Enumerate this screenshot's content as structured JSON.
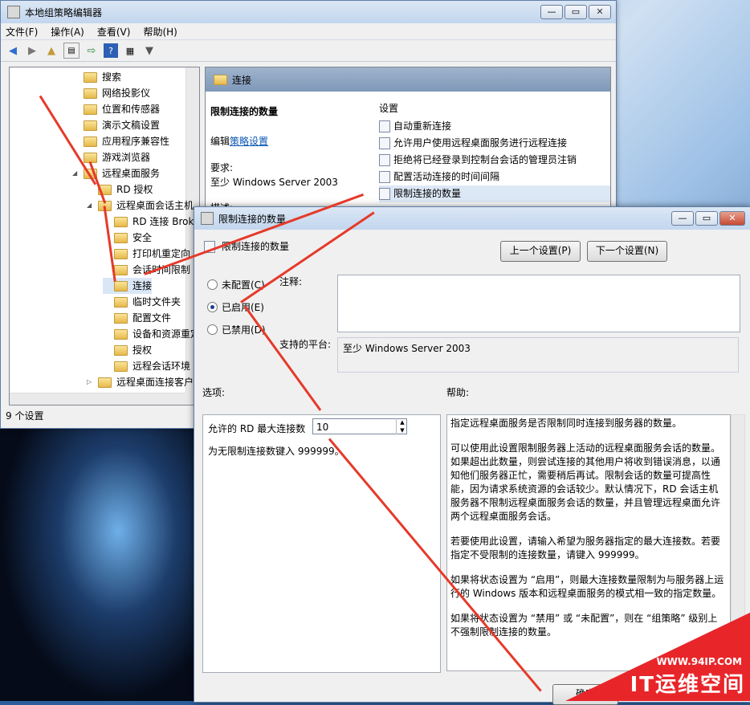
{
  "main_window": {
    "title": "本地组策略编辑器",
    "menu": [
      "文件(F)",
      "操作(A)",
      "查看(V)",
      "帮助(H)"
    ],
    "tree": [
      {
        "label": "搜索",
        "level": 0
      },
      {
        "label": "网络投影仪",
        "level": 0
      },
      {
        "label": "位置和传感器",
        "level": 0
      },
      {
        "label": "演示文稿设置",
        "level": 0
      },
      {
        "label": "应用程序兼容性",
        "level": 0
      },
      {
        "label": "游戏浏览器",
        "level": 0
      },
      {
        "label": "远程桌面服务",
        "level": 0
      },
      {
        "label": "RD 授权",
        "level": 1
      },
      {
        "label": "远程桌面会话主机",
        "level": 1
      },
      {
        "label": "RD 连接 Broke",
        "level": 2
      },
      {
        "label": "安全",
        "level": 2
      },
      {
        "label": "打印机重定向",
        "level": 2
      },
      {
        "label": "会话时间限制",
        "level": 2
      },
      {
        "label": "连接",
        "level": 2
      },
      {
        "label": "临时文件夹",
        "level": 2
      },
      {
        "label": "配置文件",
        "level": 2
      },
      {
        "label": "设备和资源重定",
        "level": 2
      },
      {
        "label": "授权",
        "level": 2
      },
      {
        "label": "远程会话环境",
        "level": 2
      },
      {
        "label": "远程桌面连接客户端",
        "level": 1
      }
    ],
    "status": "9 个设置",
    "right_panel": {
      "folder": "连接",
      "policy_title": "限制连接的数量",
      "edit_prefix": "编辑",
      "edit_link": "策略设置",
      "req_label": "要求:",
      "req_value": "至少 Windows Server 2003",
      "desc_label": "描述:",
      "settings_header": "设置",
      "settings": [
        "自动重新连接",
        "允许用户使用远程桌面服务进行远程连接",
        "拒绝将已经登录到控制台会话的管理员注销",
        "配置活动连接的时间间隔",
        "限制连接的数量"
      ]
    }
  },
  "dialog": {
    "title": "限制连接的数量",
    "heading": "限制连接的数量",
    "prev_button": "上一个设置(P)",
    "next_button": "下一个设置(N)",
    "radio_not_configured": "未配置(C)",
    "radio_enabled": "已启用(E)",
    "radio_disabled": "已禁用(D)",
    "comment_label": "注释:",
    "platform_label": "支持的平台:",
    "platform_value": "至少 Windows Server 2003",
    "options_label": "选项:",
    "help_label": "帮助:",
    "max_conn_label": "允许的 RD 最大连接数",
    "max_conn_value": "10",
    "hint": "为无限制连接数键入 999999。",
    "help_p1": "指定远程桌面服务是否限制同时连接到服务器的数量。",
    "help_p2": "可以使用此设置限制服务器上活动的远程桌面服务会话的数量。如果超出此数量，则尝试连接的其他用户将收到错误消息，以通知他们服务器正忙，需要稍后再试。限制会话的数量可提高性能，因为请求系统资源的会话较少。默认情况下，RD 会话主机服务器不限制远程桌面服务会话的数量，并且管理远程桌面允许两个远程桌面服务会话。",
    "help_p3": "若要使用此设置，请输入希望为服务器指定的最大连接数。若要指定不受限制的连接数量，请键入 999999。",
    "help_p4": "如果将状态设置为 “启用”，则最大连接数量限制为与服务器上运行的 Windows 版本和远程桌面服务的模式相一致的指定数量。",
    "help_p5": "如果将状态设置为 “禁用” 或 “未配置”，则在 “组策略” 级别上不强制限制连接的数量。",
    "ok_button": "确定"
  },
  "watermark": {
    "url": "WWW.94IP.COM",
    "brand": "IT运维空间"
  },
  "colors": {
    "arrow": "#e53a2a",
    "watermark": "#e8262a",
    "link": "#0b57b3"
  }
}
